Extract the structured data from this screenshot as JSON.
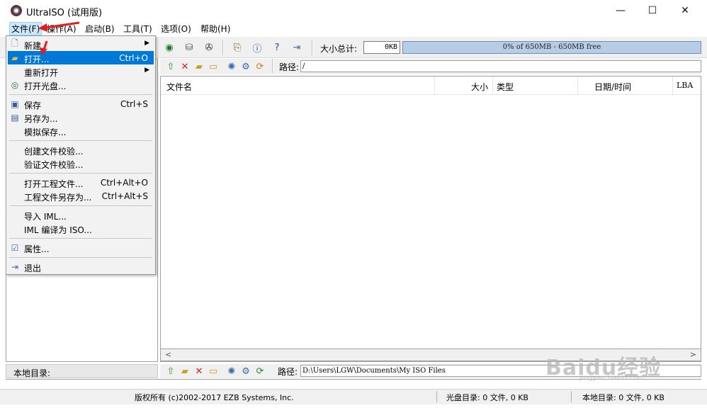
{
  "window": {
    "title": "UltraISO (试用版)",
    "controls": {
      "minimize": "—",
      "maximize": "☐",
      "close": "✕"
    }
  },
  "menubar": {
    "items": [
      "文件(F)",
      "操作(A)",
      "启动(B)",
      "工具(T)",
      "选项(O)",
      "帮助(H)"
    ]
  },
  "toolbar": {
    "size_label": "大小总计:",
    "size_value": "0KB",
    "capacity_text": "0% of 650MB - 650MB free"
  },
  "upper_path": {
    "label": "路径:",
    "value": "/"
  },
  "filelist": {
    "columns": [
      "文件名",
      "大小",
      "类型",
      "日期/时间",
      "LBA"
    ]
  },
  "file_menu": {
    "items": [
      {
        "label": "新建",
        "submenu": true,
        "icon": "new-file-icon"
      },
      {
        "label": "打开...",
        "shortcut": "Ctrl+O",
        "highlighted": true,
        "icon": "open-folder-icon"
      },
      {
        "label": "重新打开",
        "submenu": true
      },
      {
        "label": "打开光盘...",
        "icon": "open-disc-icon"
      },
      {
        "label": "保存",
        "shortcut": "Ctrl+S",
        "icon": "save-icon"
      },
      {
        "label": "另存为...",
        "icon": "save-as-icon"
      },
      {
        "label": "模拟保存..."
      },
      {
        "label": "创建文件校验..."
      },
      {
        "label": "验证文件校验..."
      },
      {
        "label": "打开工程文件...",
        "shortcut": "Ctrl+Alt+O"
      },
      {
        "label": "工程文件另存为...",
        "shortcut": "Ctrl+Alt+S"
      },
      {
        "label": "导入 IML..."
      },
      {
        "label": "IML 编译为 ISO..."
      },
      {
        "label": "属性...",
        "icon": "properties-icon"
      },
      {
        "label": "退出",
        "icon": "exit-icon"
      }
    ]
  },
  "local": {
    "label": "本地目录:",
    "path_label": "路径:",
    "path_value": "D:\\Users\\LGW\\Documents\\My ISO Files"
  },
  "statusbar": {
    "copyright": "版权所有 (c)2002-2017 EZB Systems, Inc.",
    "disc_dir": "光盘目录: 0 文件, 0 KB",
    "local_dir": "本地目录: 0 文件, 0 KB"
  },
  "watermark": {
    "brand": "Baidu经验",
    "url": "jingyan.baidu.com"
  },
  "colors": {
    "highlight": "#0078d7",
    "capacity_bar": "#b7cde5",
    "annotation_arrow": "#e02020"
  }
}
